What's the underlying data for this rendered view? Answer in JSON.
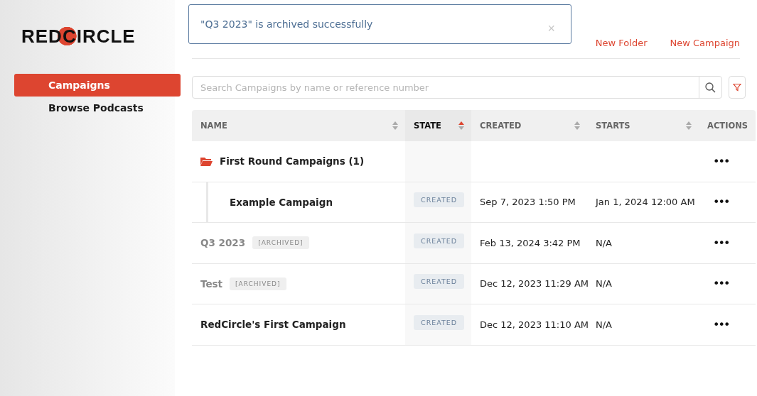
{
  "logo": {
    "text": "REDCIRCLE"
  },
  "sidebar": {
    "items": [
      {
        "label": "Campaigns",
        "selected": true
      },
      {
        "label": "Browse Podcasts",
        "selected": false
      }
    ]
  },
  "toast": {
    "message": "\"Q3 2023\" is archived successfully",
    "close": "×"
  },
  "header_actions": [
    "New Folder",
    "New Campaign"
  ],
  "search": {
    "placeholder": "Search Campaigns by name or reference number"
  },
  "table": {
    "columns": [
      {
        "label": "NAME",
        "sortable": true,
        "selected": false
      },
      {
        "label": "STATE",
        "sortable": true,
        "selected": true
      },
      {
        "label": "CREATED",
        "sortable": true,
        "selected": false
      },
      {
        "label": "STARTS",
        "sortable": true,
        "selected": false
      },
      {
        "label": "ACTIONS",
        "sortable": false,
        "selected": false
      }
    ],
    "rows": [
      {
        "kind": "folder",
        "name": "First Round Campaigns (1)",
        "actions": "•••",
        "expanded": true,
        "children": [
          {
            "kind": "campaign",
            "name": "Example Campaign",
            "archived": false,
            "state": "CREATED",
            "created": "Sep 7, 2023 1:50 PM",
            "starts": "Jan 1, 2024 12:00 AM",
            "actions": "•••"
          }
        ]
      },
      {
        "kind": "campaign",
        "name": "Q3 2023",
        "archived": true,
        "archived_label": "[ARCHIVED]",
        "state": "CREATED",
        "created": "Feb 13, 2024 3:42 PM",
        "starts": "N/A",
        "actions": "•••"
      },
      {
        "kind": "campaign",
        "name": "Test",
        "archived": true,
        "archived_label": "[ARCHIVED]",
        "state": "CREATED",
        "created": "Dec 12, 2023 11:29 AM",
        "starts": "N/A",
        "actions": "•••"
      },
      {
        "kind": "campaign",
        "name": "RedCircle's First Campaign",
        "archived": false,
        "state": "CREATED",
        "created": "Dec 12, 2023 11:10 AM",
        "starts": "N/A",
        "actions": "•••"
      }
    ]
  }
}
